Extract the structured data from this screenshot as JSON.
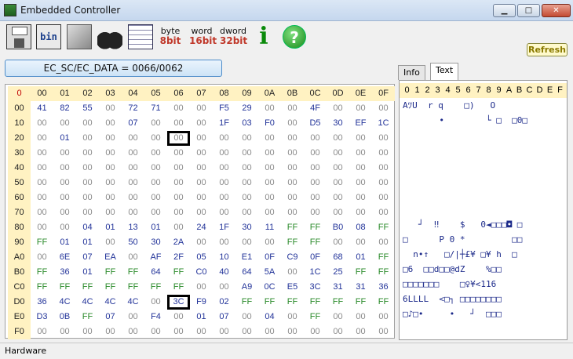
{
  "window": {
    "title": "Embedded Controller",
    "min_label": "▁",
    "max_label": "□",
    "close_label": "✕"
  },
  "toolbar": {
    "bin_label": "bin",
    "byte": {
      "top": "byte",
      "bottom": "8bit",
      "color": "#c0392b"
    },
    "word": {
      "top": "word",
      "bottom": "16bit",
      "color": "#c0392b"
    },
    "dword": {
      "top": "dword",
      "bottom": "32bit",
      "color": "#c0392b"
    },
    "info_label": "i",
    "help_label": "?",
    "refresh_label": "Refresh"
  },
  "ec_port": "EC_SC/EC_DATA = 0066/0062",
  "grid": {
    "corner": "0",
    "columns": [
      "00",
      "01",
      "02",
      "03",
      "04",
      "05",
      "06",
      "07",
      "08",
      "09",
      "0A",
      "0B",
      "0C",
      "0D",
      "0E",
      "0F"
    ],
    "rows": [
      {
        "addr": "00",
        "cells": [
          "41",
          "82",
          "55",
          "00",
          "72",
          "71",
          "00",
          "00",
          "F5",
          "29",
          "00",
          "00",
          "4F",
          "00",
          "00",
          "00"
        ]
      },
      {
        "addr": "10",
        "cells": [
          "00",
          "00",
          "00",
          "00",
          "07",
          "00",
          "00",
          "00",
          "1F",
          "03",
          "F0",
          "00",
          "D5",
          "30",
          "EF",
          "1C"
        ]
      },
      {
        "addr": "20",
        "cells": [
          "00",
          "01",
          "00",
          "00",
          "00",
          "00",
          "00",
          "00",
          "00",
          "00",
          "00",
          "00",
          "00",
          "00",
          "00",
          "00"
        ]
      },
      {
        "addr": "30",
        "cells": [
          "00",
          "00",
          "00",
          "00",
          "00",
          "00",
          "00",
          "00",
          "00",
          "00",
          "00",
          "00",
          "00",
          "00",
          "00",
          "00"
        ]
      },
      {
        "addr": "40",
        "cells": [
          "00",
          "00",
          "00",
          "00",
          "00",
          "00",
          "00",
          "00",
          "00",
          "00",
          "00",
          "00",
          "00",
          "00",
          "00",
          "00"
        ]
      },
      {
        "addr": "50",
        "cells": [
          "00",
          "00",
          "00",
          "00",
          "00",
          "00",
          "00",
          "00",
          "00",
          "00",
          "00",
          "00",
          "00",
          "00",
          "00",
          "00"
        ]
      },
      {
        "addr": "60",
        "cells": [
          "00",
          "00",
          "00",
          "00",
          "00",
          "00",
          "00",
          "00",
          "00",
          "00",
          "00",
          "00",
          "00",
          "00",
          "00",
          "00"
        ]
      },
      {
        "addr": "70",
        "cells": [
          "00",
          "00",
          "00",
          "00",
          "00",
          "00",
          "00",
          "00",
          "00",
          "00",
          "00",
          "00",
          "00",
          "00",
          "00",
          "00"
        ]
      },
      {
        "addr": "80",
        "cells": [
          "00",
          "00",
          "04",
          "01",
          "13",
          "01",
          "00",
          "24",
          "1F",
          "30",
          "11",
          "FF",
          "FF",
          "B0",
          "08",
          "FF"
        ]
      },
      {
        "addr": "90",
        "cells": [
          "FF",
          "01",
          "01",
          "00",
          "50",
          "30",
          "2A",
          "00",
          "00",
          "00",
          "00",
          "FF",
          "FF",
          "00",
          "00",
          "00"
        ]
      },
      {
        "addr": "A0",
        "cells": [
          "00",
          "6E",
          "07",
          "EA",
          "00",
          "AF",
          "2F",
          "05",
          "10",
          "E1",
          "0F",
          "C9",
          "0F",
          "68",
          "01",
          "FF"
        ]
      },
      {
        "addr": "B0",
        "cells": [
          "FF",
          "36",
          "01",
          "FF",
          "FF",
          "64",
          "FF",
          "C0",
          "40",
          "64",
          "5A",
          "00",
          "1C",
          "25",
          "FF",
          "FF"
        ]
      },
      {
        "addr": "C0",
        "cells": [
          "FF",
          "FF",
          "FF",
          "FF",
          "FF",
          "FF",
          "FF",
          "00",
          "00",
          "A9",
          "0C",
          "E5",
          "3C",
          "31",
          "31",
          "36"
        ]
      },
      {
        "addr": "D0",
        "cells": [
          "36",
          "4C",
          "4C",
          "4C",
          "4C",
          "00",
          "3C",
          "F9",
          "02",
          "FF",
          "FF",
          "FF",
          "FF",
          "FF",
          "FF",
          "FF"
        ]
      },
      {
        "addr": "E0",
        "cells": [
          "D3",
          "0B",
          "FF",
          "07",
          "00",
          "F4",
          "00",
          "01",
          "07",
          "00",
          "04",
          "00",
          "FF",
          "00",
          "00",
          "00"
        ]
      },
      {
        "addr": "F0",
        "cells": [
          "00",
          "00",
          "00",
          "00",
          "00",
          "00",
          "00",
          "00",
          "00",
          "00",
          "00",
          "00",
          "00",
          "00",
          "00",
          "00"
        ]
      }
    ],
    "highlighted": [
      "20:06",
      "D0:06"
    ]
  },
  "tabs": [
    {
      "label": "Info",
      "active": false
    },
    {
      "label": "Text",
      "active": true
    }
  ],
  "text_panel": {
    "columns": [
      "0",
      "1",
      "2",
      "3",
      "4",
      "5",
      "6",
      "7",
      "8",
      "9",
      "A",
      "B",
      "C",
      "D",
      "E",
      "F"
    ],
    "rows": [
      "AﾂU  r q    □)   O",
      "       •        └ □  □0□",
      "",
      "",
      "",
      "",
      "",
      "",
      "   ┘  ‼    $   0◄□□□◘ □",
      "□      P 0 *         □□",
      "  n•↑   □/|┼£¥ □¥ h  □",
      "□6  □□d□□@dZ    %□□",
      "□□□□□□□    □♀¥<116",
      "6LLLL  <□┐ □□□□□□□□",
      "□♪□•     •   ┘  □□□",
      ""
    ]
  },
  "status": {
    "text": "Hardware"
  }
}
